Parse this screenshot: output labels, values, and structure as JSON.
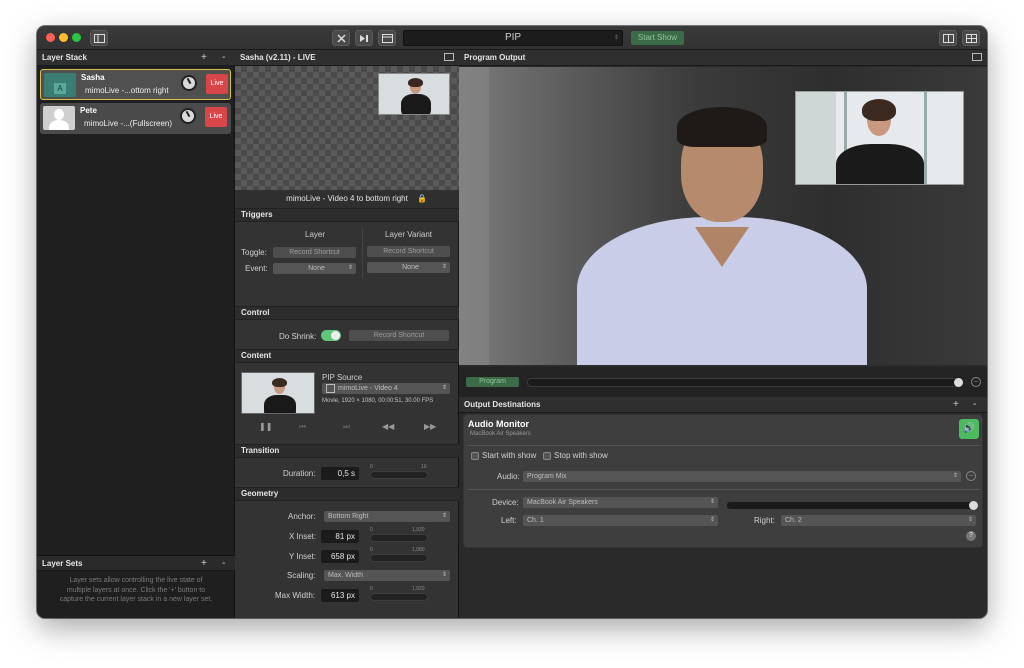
{
  "titlebar": {
    "source_name": "PIP",
    "start_show_label": "Start Show"
  },
  "layer_stack": {
    "title": "Layer Stack",
    "add_label": "+",
    "remove_label": "-",
    "layers": [
      {
        "name": "Sasha",
        "subtitle": "mimoLive -...ottom right",
        "thumb_letter": "A",
        "live_label": "Live"
      },
      {
        "name": "Pete",
        "subtitle": "mimoLive -...(Fullscreen)",
        "live_label": "Live"
      }
    ]
  },
  "layer_sets": {
    "title": "Layer Sets",
    "add_label": "+",
    "remove_label": "-",
    "help_text": "Layer sets allow controlling the live state of multiple layers at once. Click the '+' button to capture the current layer stack in a new layer set."
  },
  "inspector": {
    "title": "Sasha (v2.11) - LIVE",
    "preview_caption": "mimoLive - Video 4 to bottom right",
    "triggers": {
      "title": "Triggers",
      "col_layer": "Layer",
      "col_variant": "Layer Variant",
      "toggle_label": "Toggle:",
      "event_label": "Event:",
      "shortcut_placeholder": "Record Shortcut",
      "event_layer_value": "None",
      "event_variant_value": "None"
    },
    "control": {
      "title": "Control",
      "do_shrink_label": "Do Shrink:",
      "shortcut_placeholder": "Record Shortcut"
    },
    "content": {
      "title": "Content",
      "pip_source_label": "PIP Source",
      "pip_source_value": "mimoLive - Video 4",
      "media_info": "Movie, 1920 × 1080, 00:00:51, 30.00 FPS"
    },
    "transition": {
      "title": "Transition",
      "duration_label": "Duration:",
      "duration_value": "0,5 s",
      "slider_min": "0",
      "slider_max": "10"
    },
    "geometry": {
      "title": "Geometry",
      "anchor_label": "Anchor:",
      "anchor_value": "Bottom Right",
      "x_inset_label": "X Inset:",
      "x_inset_value": "81 px",
      "x_min": "0",
      "x_max": "1,920",
      "y_inset_label": "Y Inset:",
      "y_inset_value": "658 px",
      "y_min": "0",
      "y_max": "1,080",
      "scaling_label": "Scaling:",
      "scaling_value": "Max. Width",
      "max_width_label": "Max Width:",
      "max_width_value": "613 px",
      "w_min": "0",
      "w_max": "1,920"
    }
  },
  "program_output": {
    "title": "Program Output",
    "program_label": "Program"
  },
  "output_destinations": {
    "title": "Output Destinations",
    "add_label": "+",
    "remove_label": "-",
    "audio_monitor": {
      "title": "Audio Monitor",
      "subtitle": "MacBook Air Speakers",
      "start_with_show": "Start with show",
      "stop_with_show": "Stop with show",
      "audio_label": "Audio:",
      "audio_value": "Program Mix",
      "device_label": "Device:",
      "device_value": "MacBook Air Speakers",
      "left_label": "Left:",
      "left_value": "Ch. 1",
      "right_label": "Right:",
      "right_value": "Ch. 2",
      "help_label": "?"
    }
  },
  "colors": {
    "live": "#d9464a",
    "selected_border": "#d7c14a",
    "toggle_on": "#5fc77a",
    "speaker_button": "#4cba5f"
  }
}
